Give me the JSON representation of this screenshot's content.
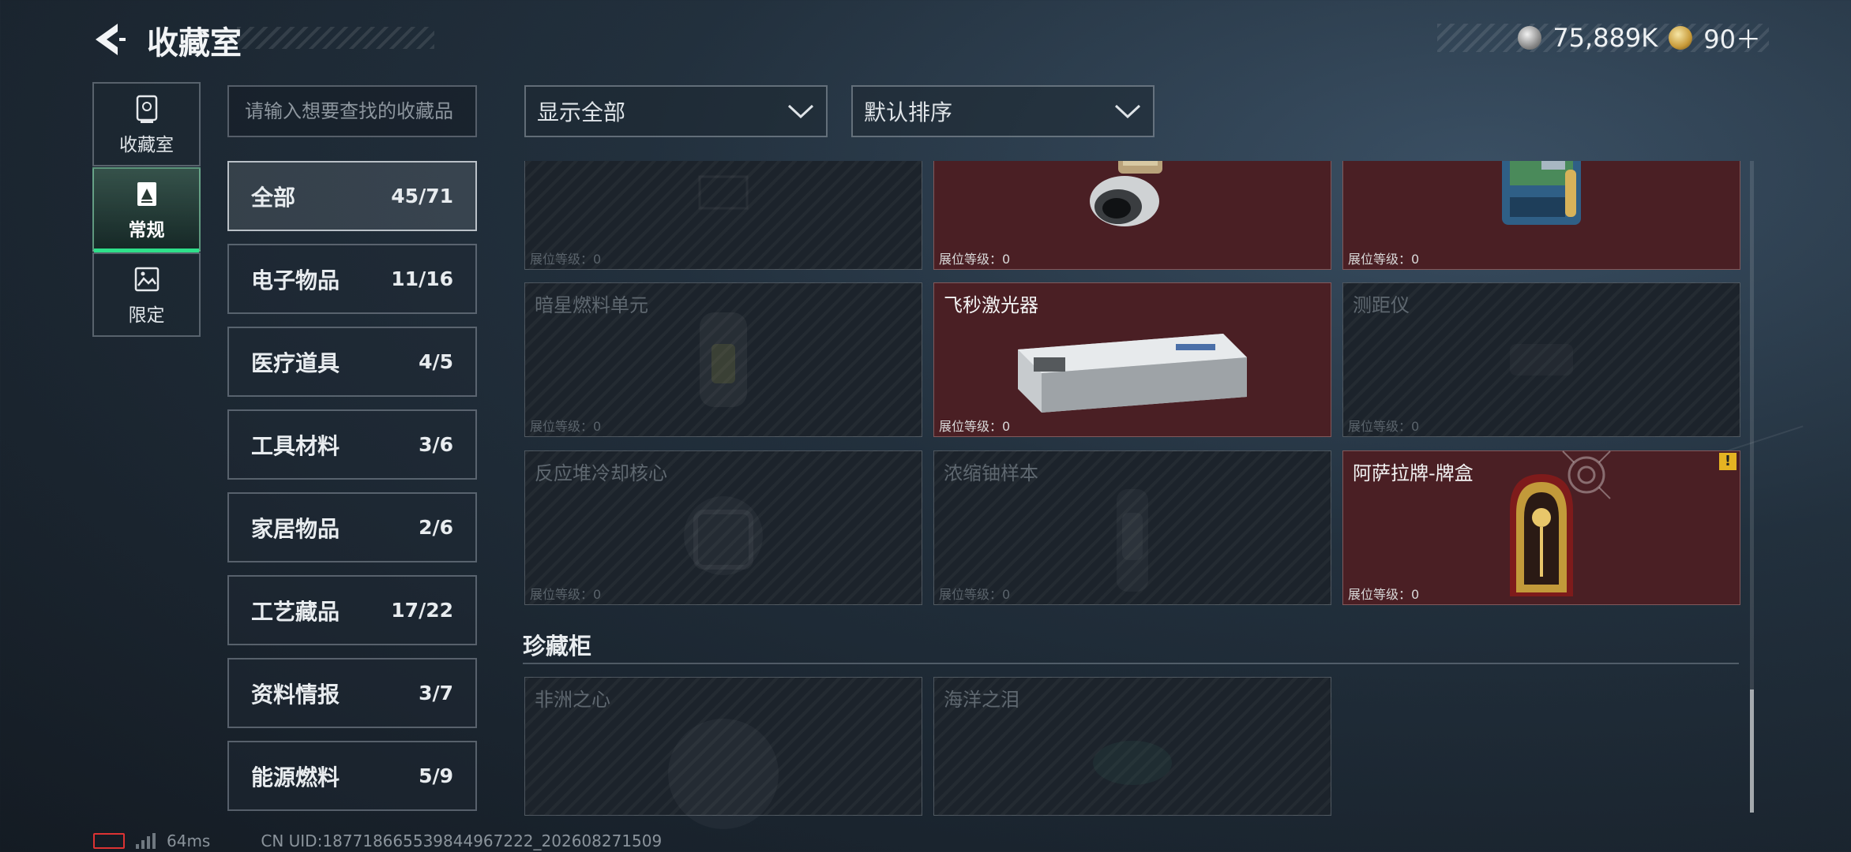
{
  "header": {
    "title": "收藏室",
    "currency": [
      {
        "icon": "silver-coin-icon",
        "value": "75,889K"
      },
      {
        "icon": "gold-coin-icon",
        "value": "90＋"
      }
    ]
  },
  "side_nav": [
    {
      "label": "收藏室",
      "icon": "vault-icon",
      "active": false
    },
    {
      "label": "常规",
      "icon": "display-frame-icon",
      "active": true
    },
    {
      "label": "限定",
      "icon": "picture-icon",
      "active": false
    }
  ],
  "search": {
    "placeholder": "请输入想要查找的收藏品"
  },
  "categories": [
    {
      "name": "全部",
      "count": "45/71",
      "active": true
    },
    {
      "name": "电子物品",
      "count": "11/16"
    },
    {
      "name": "医疗道具",
      "count": "4/5"
    },
    {
      "name": "工具材料",
      "count": "3/6"
    },
    {
      "name": "家居物品",
      "count": "2/6"
    },
    {
      "name": "工艺藏品",
      "count": "17/22"
    },
    {
      "name": "资料情报",
      "count": "3/7"
    },
    {
      "name": "能源燃料",
      "count": "5/9"
    }
  ],
  "filters": {
    "show": "显示全部",
    "sort": "默认排序"
  },
  "items": [
    {
      "name": "",
      "level": "展位等级：0",
      "owned": false,
      "icon": "item-placeholder-icon"
    },
    {
      "name": "",
      "level": "展位等级：0",
      "owned": true,
      "icon": "lens-module-icon"
    },
    {
      "name": "",
      "level": "展位等级：0",
      "owned": true,
      "icon": "circuit-device-icon"
    },
    {
      "name": "暗星燃料单元",
      "level": "展位等级：0",
      "owned": false,
      "icon": "fuel-cell-icon"
    },
    {
      "name": "飞秒激光器",
      "level": "展位等级：0",
      "owned": true,
      "icon": "laser-device-icon"
    },
    {
      "name": "测距仪",
      "level": "展位等级：0",
      "owned": false,
      "icon": "rangefinder-icon"
    },
    {
      "name": "反应堆冷却核心",
      "level": "展位等级：0",
      "owned": false,
      "icon": "reactor-core-icon"
    },
    {
      "name": "浓缩铀样本",
      "level": "展位等级：0",
      "owned": false,
      "icon": "uranium-sample-icon"
    },
    {
      "name": "阿萨拉牌-牌盒",
      "level": "展位等级：0",
      "owned": true,
      "icon": "card-box-icon",
      "alert": "!"
    }
  ],
  "showcase": {
    "title": "珍藏柜",
    "items": [
      {
        "name": "非洲之心",
        "owned": false,
        "icon": "gem-icon"
      },
      {
        "name": "海洋之泪",
        "owned": false,
        "icon": "gem-icon"
      }
    ]
  },
  "status_bar": {
    "ping": "64ms",
    "uid": "CN UID:18771866553984496722​2_202608271509"
  }
}
